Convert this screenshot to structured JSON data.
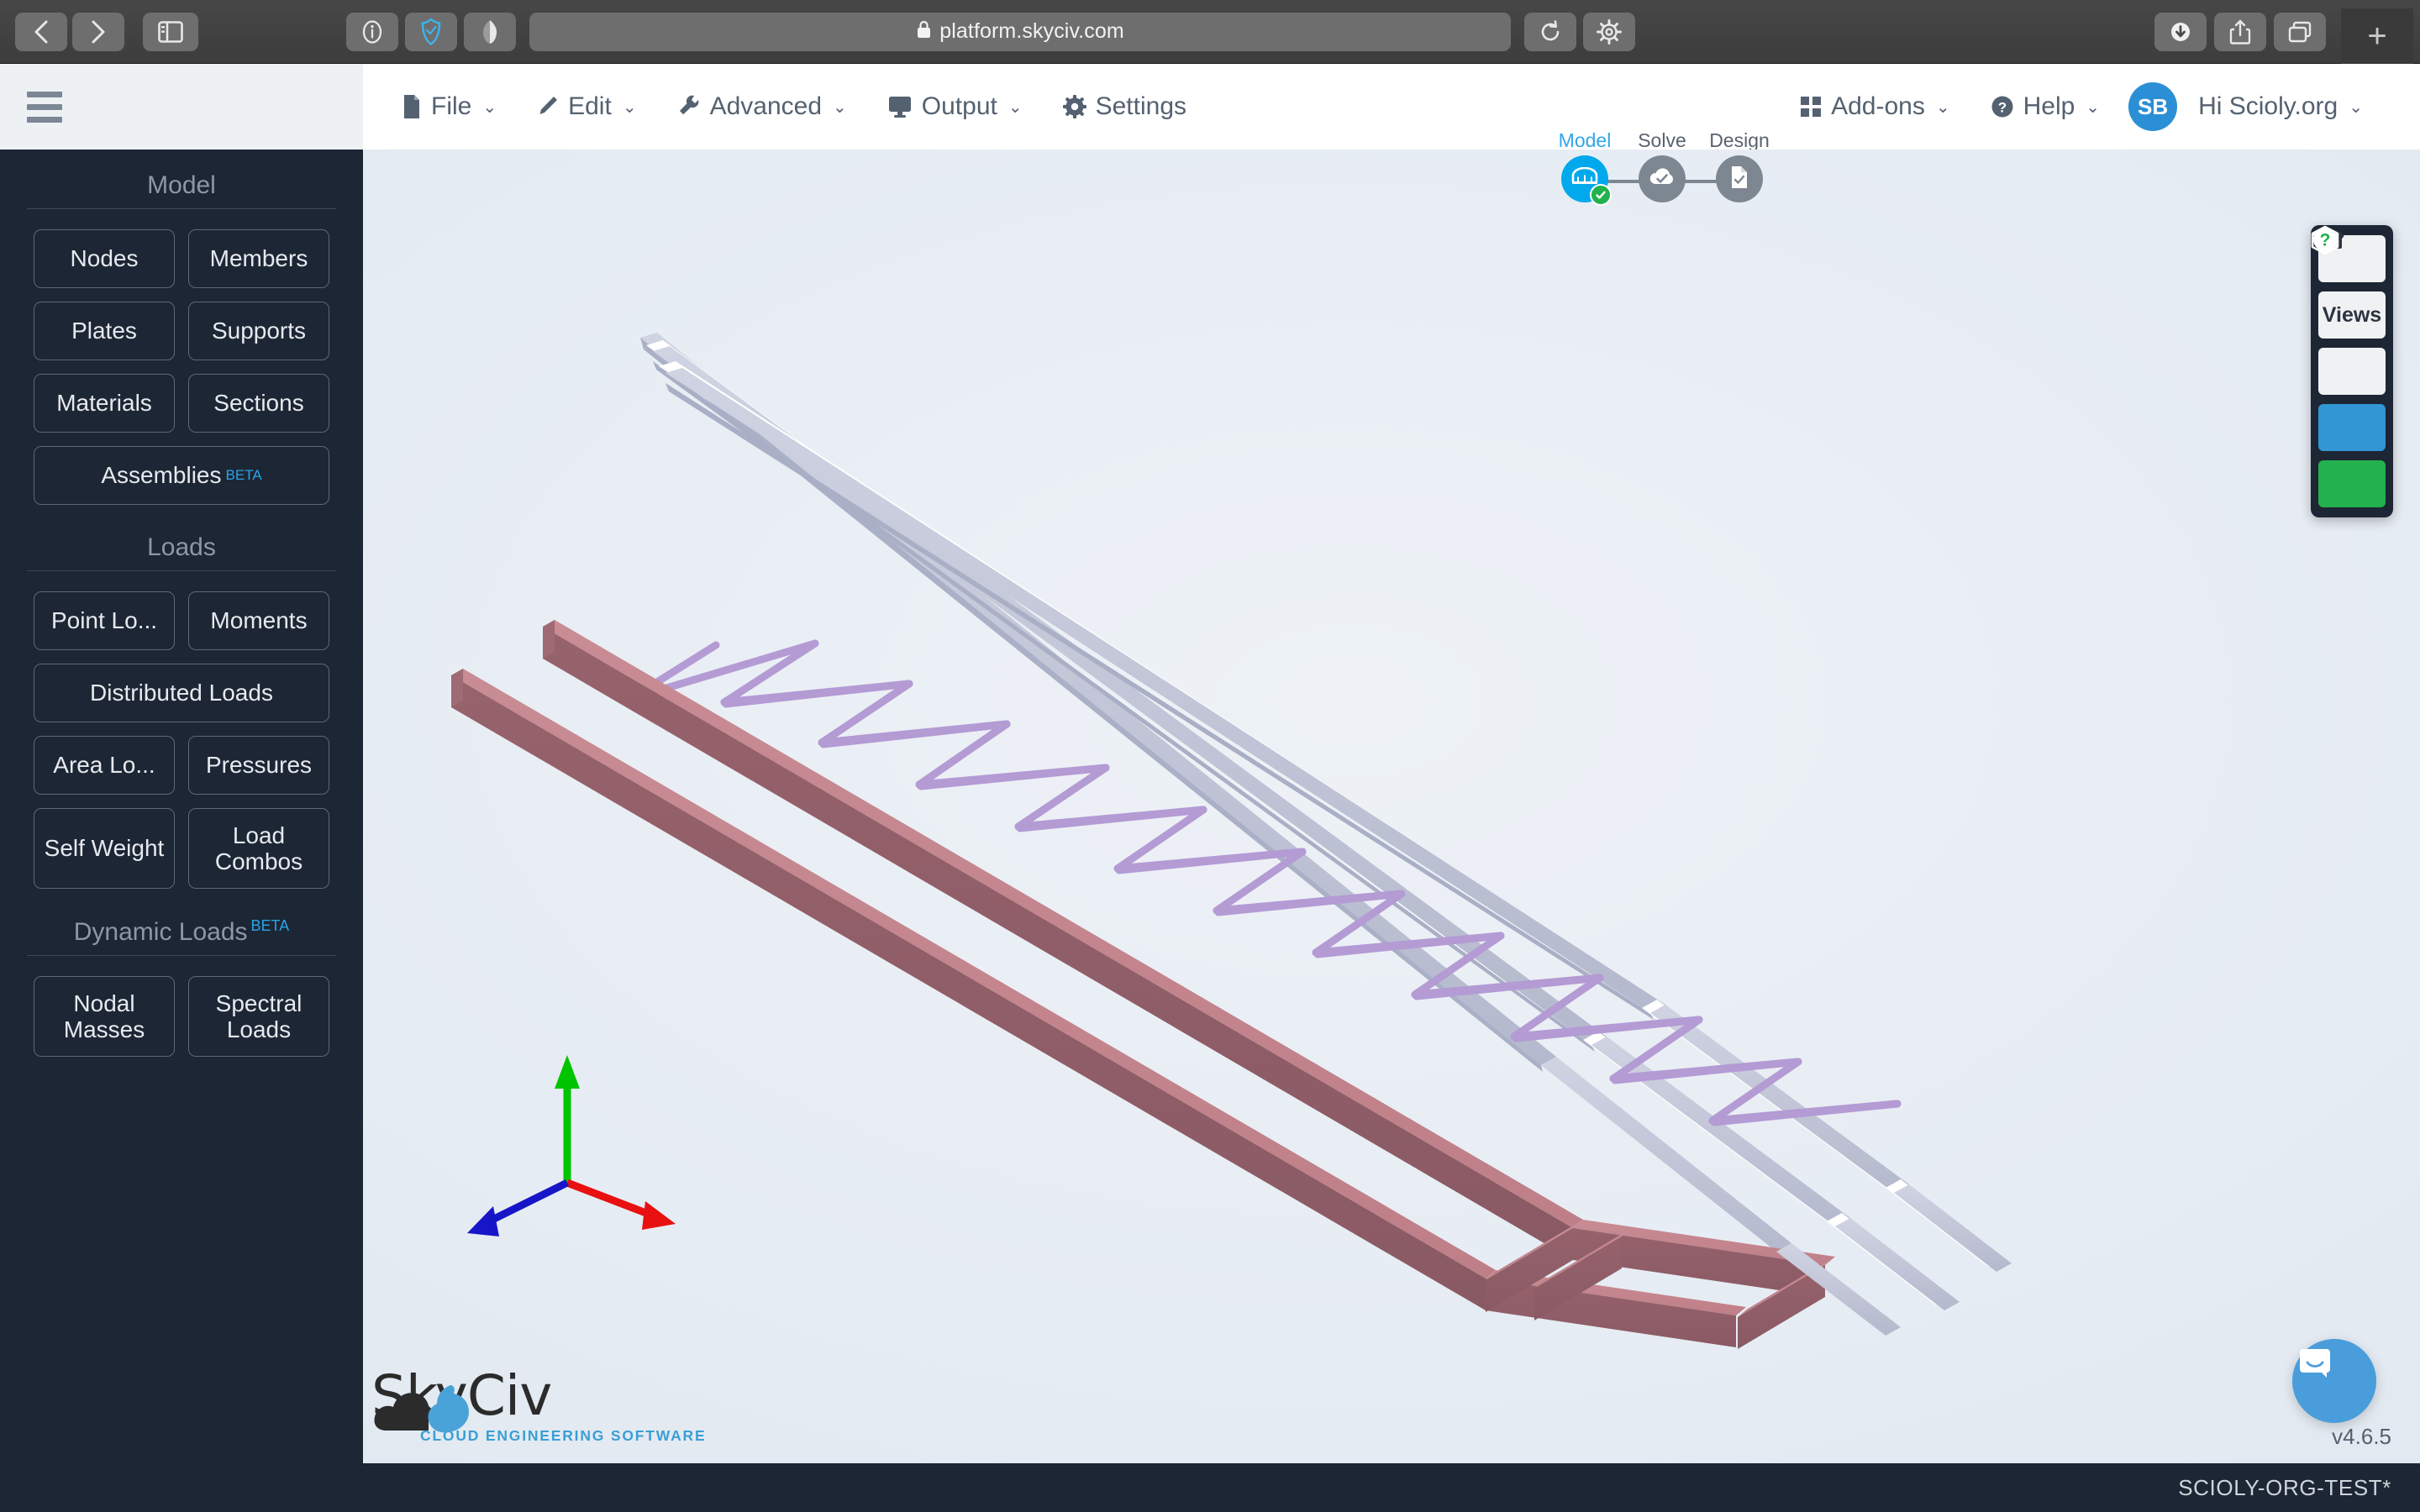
{
  "browser": {
    "url": "platform.skyciv.com",
    "lock_icon": "lock-icon",
    "buttons": {
      "back": "back-icon",
      "forward": "forward-icon",
      "sidebar": "sidebar-toggle-icon",
      "info": "info-icon",
      "shield": "shield-check-icon",
      "contrast": "reader-contrast-icon",
      "reload": "reload-icon",
      "settings": "gear-icon",
      "download": "download-icon",
      "share": "share-icon",
      "tabs": "tab-overview-icon",
      "newtab": "+"
    }
  },
  "menubar": {
    "hamburger": "hamburger-icon",
    "items": [
      {
        "label": "File",
        "icon": "file-icon",
        "caret": "⌄"
      },
      {
        "label": "Edit",
        "icon": "pencil-icon",
        "caret": "⌄"
      },
      {
        "label": "Advanced",
        "icon": "wrench-icon",
        "caret": "⌄"
      },
      {
        "label": "Output",
        "icon": "monitor-icon",
        "caret": "⌄"
      },
      {
        "label": "Settings",
        "icon": "gear-icon",
        "caret": ""
      }
    ],
    "right_items": [
      {
        "label": "Add-ons",
        "icon": "grid-icon",
        "caret": "⌄"
      },
      {
        "label": "Help",
        "icon": "question-circle-icon",
        "caret": "⌄"
      }
    ],
    "user": {
      "initials": "SB",
      "greeting": "Hi Scioly.org",
      "caret": "⌄"
    }
  },
  "progress": {
    "steps": [
      {
        "label": "Model",
        "state": "active",
        "icon": "bridge-icon",
        "complete": true
      },
      {
        "label": "Solve",
        "state": "inactive",
        "icon": "cloud-check-icon",
        "complete": false
      },
      {
        "label": "Design",
        "state": "inactive",
        "icon": "doc-check-icon",
        "complete": false
      }
    ],
    "active_color": "#2fa8e8",
    "inactive_color": "#58626e",
    "active_circle_color": "#00a9ec",
    "inactive_circle_color": "#7d8792",
    "check_color": "#22b14c"
  },
  "sidebar": {
    "sections": [
      {
        "title": "Model",
        "beta": "",
        "buttons": [
          {
            "label": "Nodes",
            "beta": "",
            "full": false
          },
          {
            "label": "Members",
            "beta": "",
            "full": false
          },
          {
            "label": "Plates",
            "beta": "",
            "full": false
          },
          {
            "label": "Supports",
            "beta": "",
            "full": false
          },
          {
            "label": "Materials",
            "beta": "",
            "full": false
          },
          {
            "label": "Sections",
            "beta": "",
            "full": false
          },
          {
            "label": "Assemblies",
            "beta": "BETA",
            "full": true
          }
        ]
      },
      {
        "title": "Loads",
        "beta": "",
        "buttons": [
          {
            "label": "Point Lo...",
            "beta": "",
            "full": false
          },
          {
            "label": "Moments",
            "beta": "",
            "full": false
          },
          {
            "label": "Distributed Loads",
            "beta": "",
            "full": true
          },
          {
            "label": "Area Lo...",
            "beta": "",
            "full": false
          },
          {
            "label": "Pressures",
            "beta": "",
            "full": false
          },
          {
            "label": "Self Weight",
            "beta": "",
            "full": false
          },
          {
            "label": "Load Combos",
            "beta": "",
            "full": false
          }
        ]
      },
      {
        "title": "Dynamic Loads",
        "beta": "BETA",
        "buttons": [
          {
            "label": "Nodal Masses",
            "beta": "",
            "full": false
          },
          {
            "label": "Spectral Loads",
            "beta": "",
            "full": false
          }
        ]
      }
    ]
  },
  "view_toolbar": {
    "buttons": [
      {
        "name": "visibility",
        "icon": "eye-icon",
        "label": "",
        "style": "light"
      },
      {
        "name": "views",
        "icon": "",
        "label": "Views",
        "style": "light"
      },
      {
        "name": "screenshot",
        "icon": "camera-icon",
        "label": "",
        "style": "light"
      },
      {
        "name": "3d-toggle",
        "icon": "cube-icon",
        "label": "",
        "style": "blue"
      },
      {
        "name": "help",
        "icon": "question-icon",
        "label": "",
        "style": "green"
      }
    ]
  },
  "viewport": {
    "version": "v4.6.5",
    "logo": {
      "name": "SkyCiv",
      "tagline": "CLOUD ENGINEERING SOFTWARE"
    },
    "axis_triad": {
      "y_axis_color": "#00c400",
      "x_axis_color": "#e81010",
      "z_axis_color": "#1616c8"
    },
    "model": {
      "chord_color": "#c08089",
      "chord_shade_color": "#8f5f68",
      "web_color": "#b49bd4",
      "top_member_color": "#b9bdd4",
      "description": "3D truss bridge model: two maroon chord beams with purple web bracing and light-gray top stringers"
    },
    "intercom_icon": "chat-bubble-icon"
  },
  "statusbar": {
    "project_name": "SCIOLY-ORG-TEST*"
  }
}
